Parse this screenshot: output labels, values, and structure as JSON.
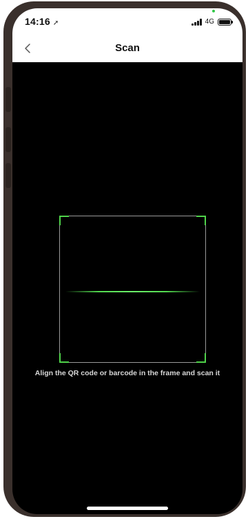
{
  "status_bar": {
    "time": "14:16",
    "location_icon": "location-arrow-icon",
    "network": "4G",
    "signal_icon": "signal-bars-icon",
    "battery_icon": "battery-icon"
  },
  "nav_bar": {
    "back_icon": "chevron-left-icon",
    "title": "Scan"
  },
  "scanner": {
    "hint": "Align the QR code or barcode in the frame and scan it",
    "accent_color": "#4fd34a"
  }
}
